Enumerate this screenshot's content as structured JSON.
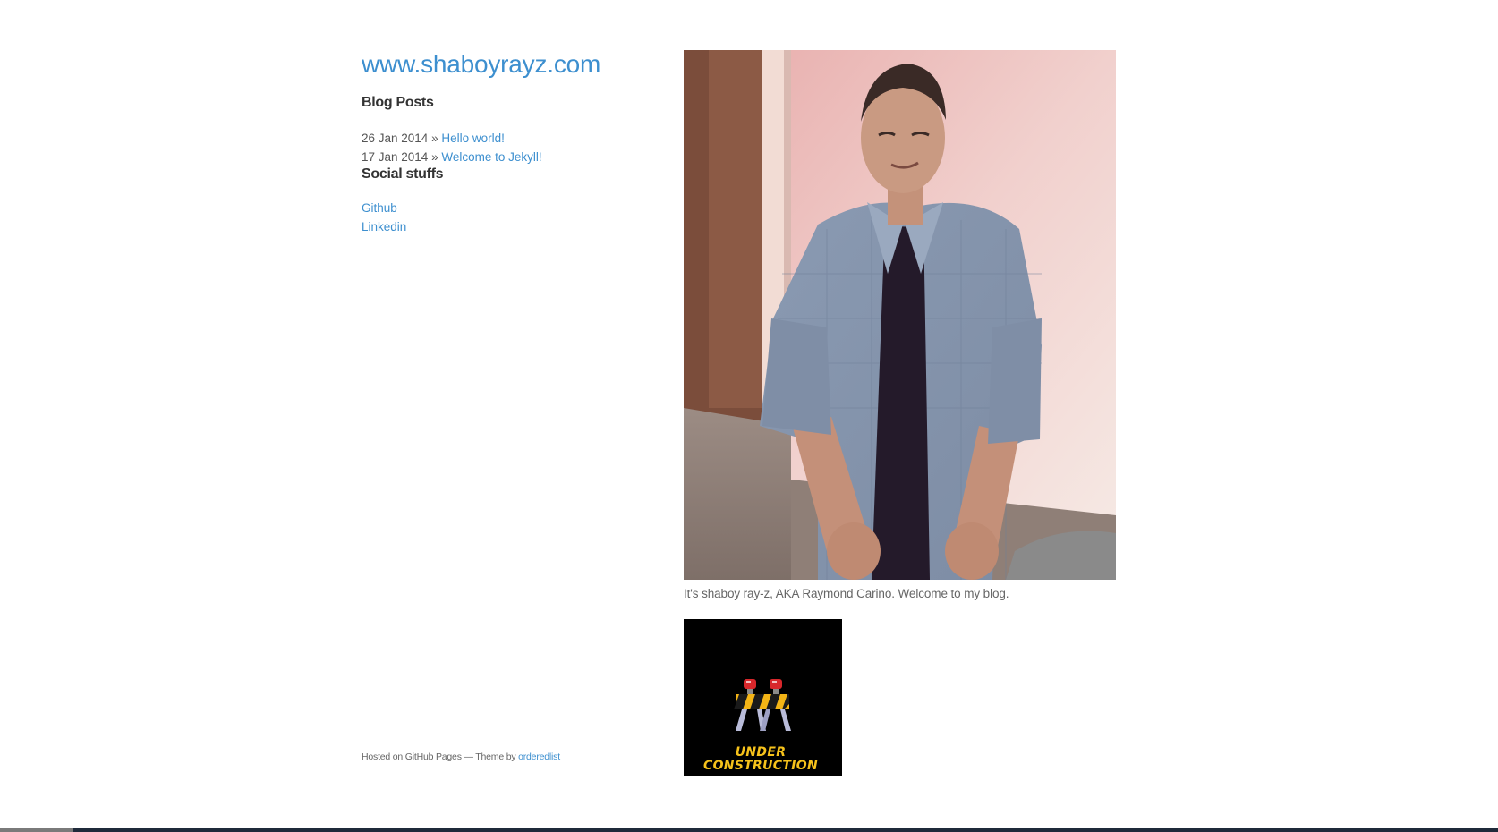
{
  "site": {
    "title": "www.shaboyrayz.com"
  },
  "blog": {
    "heading": "Blog Posts",
    "posts": [
      {
        "date": "26 Jan 2014",
        "separator": "»",
        "title": "Hello world!"
      },
      {
        "date": "17 Jan 2014",
        "separator": "»",
        "title": "Welcome to Jekyll!"
      }
    ]
  },
  "social": {
    "heading": "Social stuffs",
    "links": [
      {
        "label": "Github"
      },
      {
        "label": "Linkedin"
      }
    ]
  },
  "footer": {
    "hosted_text": "Hosted on GitHub Pages — Theme by",
    "theme_link": "orderedlist"
  },
  "main": {
    "caption": "It's shaboy ray-z, AKA Raymond Carino. Welcome to my blog.",
    "construction": {
      "line1": "UNDER",
      "line2": "CONSTRUCTION"
    }
  },
  "colors": {
    "link": "#3d8fcf",
    "heading": "#333333",
    "text": "#555555",
    "construction_text": "#f6c21b"
  }
}
